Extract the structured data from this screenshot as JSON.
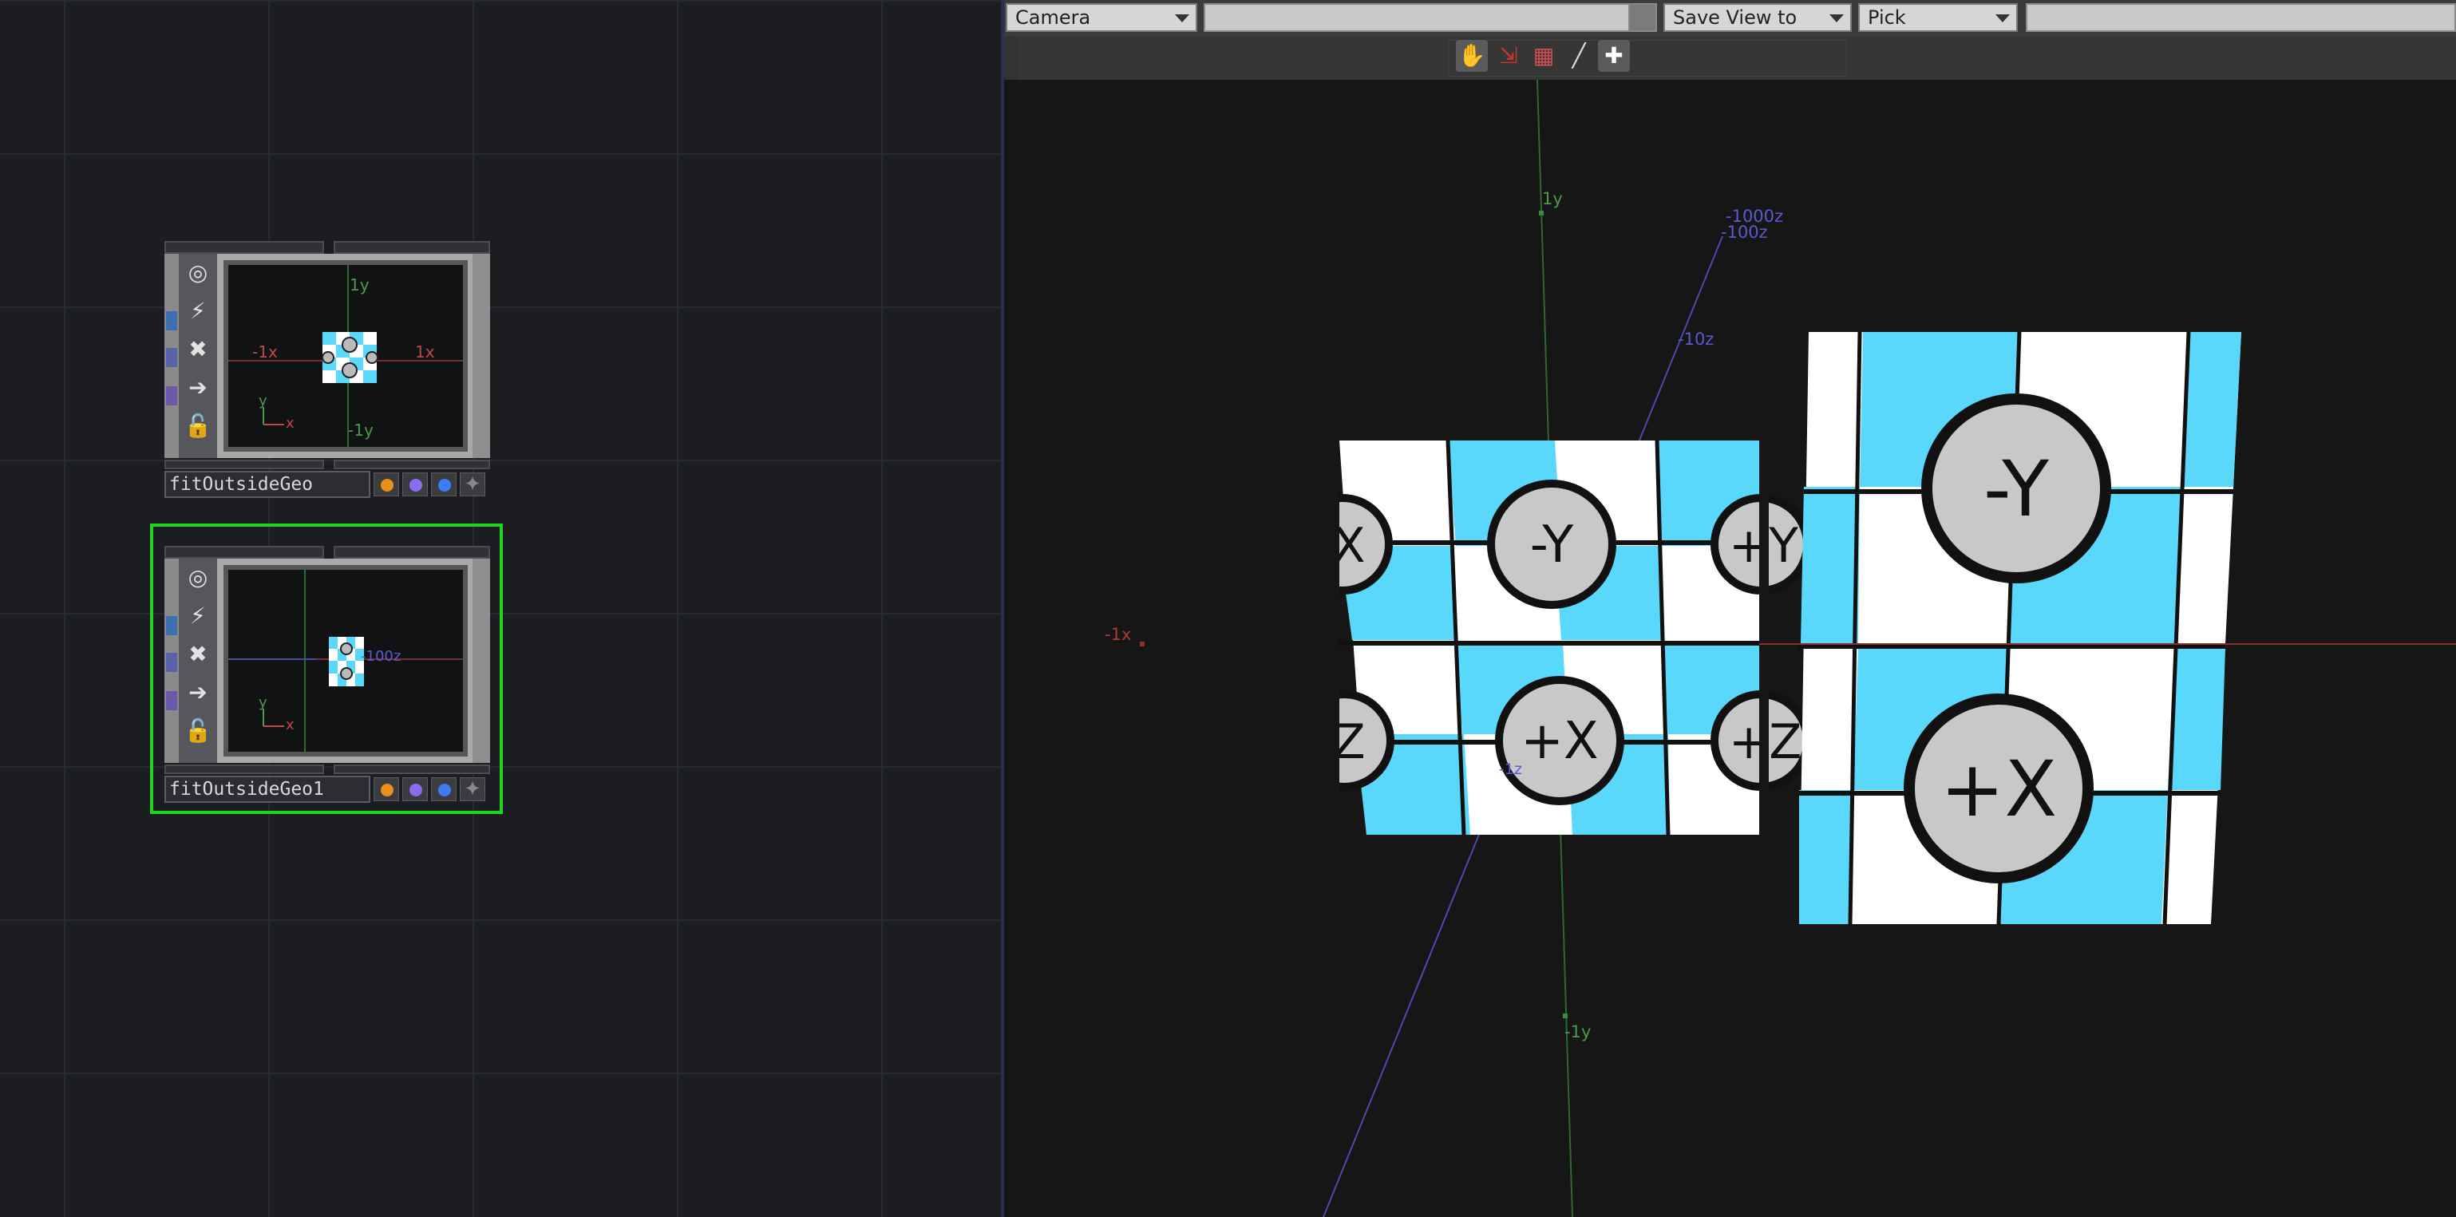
{
  "network": {
    "nodes": [
      {
        "label": "fitOutsideGeo",
        "axis_labels": {
          "pos_y": "1y",
          "neg_y": "-1y",
          "neg_x": "-1x",
          "pos_x": "1x"
        },
        "gizmo": {
          "y": "y",
          "x": "x"
        }
      },
      {
        "label": "fitOutsideGeo1",
        "axis_labels": {
          "z": "-100z"
        },
        "gizmo": {
          "y": "y",
          "x": "x"
        }
      }
    ],
    "node_icons": [
      "target-icon",
      "pulse-icon",
      "close-icon",
      "arrow-right-icon",
      "lock-icon"
    ],
    "flag_colors": [
      "#e8901a",
      "#8a6cf0",
      "#3f7bf2"
    ]
  },
  "viewer": {
    "camera_select": "Camera",
    "save_view_select": "Save View to",
    "pick_select": "Pick",
    "tools": [
      "hand-icon",
      "select-icon",
      "grid-icon",
      "bone-icon",
      "add-icon"
    ],
    "axis_labels": {
      "pos_y": "1y",
      "neg_y": "-1y",
      "neg_x": "-1x",
      "z_far": "-1000z",
      "z_mid": "-100z",
      "z_near": "-10z",
      "z_small": "-1z"
    },
    "tile_labels": {
      "left_top": [
        "X",
        "-Y",
        "+Y"
      ],
      "left_bottom": [
        "Z",
        "+X",
        "+Z"
      ],
      "right_top": "-Y",
      "right_bottom": "+X"
    }
  },
  "colors": {
    "accent_selected": "#1fd41f",
    "tile_blue": "#5ad8fb",
    "axis_x": "#a83a3a",
    "axis_y": "#3c7a3c",
    "axis_z": "#5a5ad0"
  }
}
